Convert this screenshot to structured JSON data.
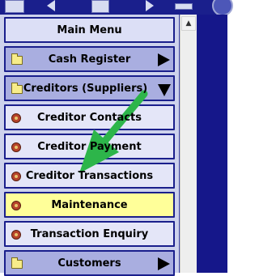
{
  "toolbar": {
    "icons": [
      "window-icon",
      "back-arrow-icon",
      "document-icon",
      "forward-arrow-icon",
      "bar-icon",
      "circle-icon"
    ]
  },
  "menu": {
    "title": "Main Menu",
    "items": [
      {
        "label": "Cash Register",
        "icon": "folder-icon",
        "type": "category",
        "indicator": "arrow-right"
      },
      {
        "label": "Creditors (Suppliers)",
        "icon": "folder-icon",
        "type": "category",
        "indicator": "arrow-down"
      },
      {
        "label": "Creditor Contacts",
        "icon": "target-icon",
        "type": "sub"
      },
      {
        "label": "Creditor Payment",
        "icon": "target-icon",
        "type": "sub"
      },
      {
        "label": "Creditor Transactions",
        "icon": "target-icon",
        "type": "sub"
      },
      {
        "label": "Maintenance",
        "icon": "target-icon",
        "type": "sub",
        "state": "active"
      },
      {
        "label": "Transaction Enquiry",
        "icon": "target-icon",
        "type": "sub"
      },
      {
        "label": "Customers",
        "icon": "folder-icon",
        "type": "category",
        "indicator": "arrow-right"
      }
    ]
  },
  "colors": {
    "frame": "#1a1f8c",
    "category_bg": "#a9aee0",
    "item_bg": "#e4e6f8",
    "active_bg": "#ffff99",
    "annotation_arrow": "#2db54a"
  },
  "scrollbar": {
    "up_glyph": "▲"
  }
}
